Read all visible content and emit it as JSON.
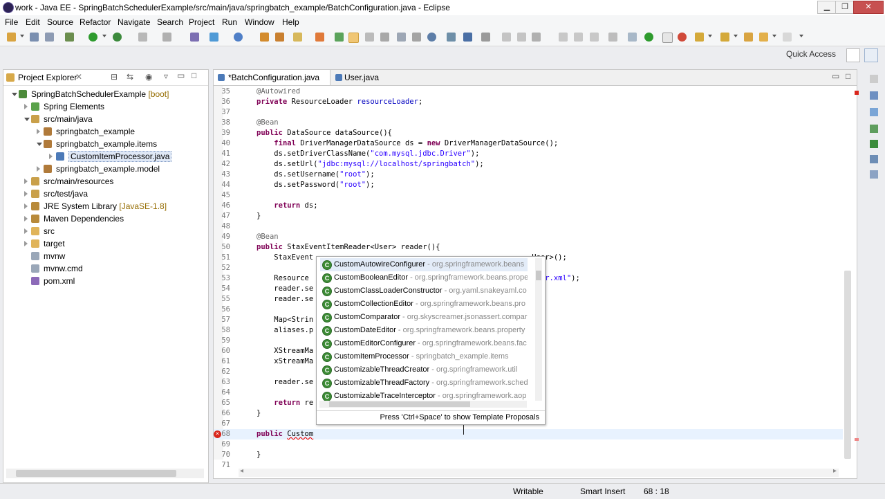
{
  "window": {
    "title": "work - Java EE - SpringBatchSchedulerExample/src/main/java/springbatch_example/BatchConfiguration.java - Eclipse",
    "minimize": "▁",
    "maximize": "❐",
    "close": "✕"
  },
  "menu": [
    "File",
    "Edit",
    "Source",
    "Refactor",
    "Navigate",
    "Search",
    "Project",
    "Run",
    "Window",
    "Help"
  ],
  "toolbar": {
    "quick_access": "Quick Access"
  },
  "explorer": {
    "title": "Project Explorer",
    "tree": [
      {
        "label": "SpringBatchSchedulerExample",
        "decoration": " [boot]",
        "icon": "project-icon",
        "expanded": true
      },
      {
        "label": "Spring Elements",
        "icon": "spring-icon",
        "expanded": false
      },
      {
        "label": "src/main/java",
        "icon": "source-folder-icon",
        "expanded": true
      },
      {
        "label": "springbatch_example",
        "icon": "package-icon",
        "expanded": false
      },
      {
        "label": "springbatch_example.items",
        "icon": "package-icon",
        "expanded": true
      },
      {
        "label": "CustomItemProcessor.java",
        "icon": "java-file-icon",
        "expanded": false,
        "selected": true
      },
      {
        "label": "springbatch_example.model",
        "icon": "package-icon",
        "expanded": false
      },
      {
        "label": "src/main/resources",
        "icon": "source-folder-icon",
        "expanded": false
      },
      {
        "label": "src/test/java",
        "icon": "source-folder-icon",
        "expanded": false
      },
      {
        "label": "JRE System Library",
        "decoration": " [JavaSE-1.8]",
        "icon": "library-icon",
        "expanded": false
      },
      {
        "label": "Maven Dependencies",
        "icon": "library-icon",
        "expanded": false
      },
      {
        "label": "src",
        "icon": "folder-icon",
        "expanded": false
      },
      {
        "label": "target",
        "icon": "folder-icon",
        "expanded": false
      },
      {
        "label": "mvnw",
        "icon": "file-icon",
        "expanded": null
      },
      {
        "label": "mvnw.cmd",
        "icon": "file-icon",
        "expanded": null
      },
      {
        "label": "pom.xml",
        "icon": "xml-file-icon",
        "expanded": null
      }
    ]
  },
  "editor": {
    "tabs": [
      {
        "label": "*BatchConfiguration.java",
        "active": true
      },
      {
        "label": "User.java",
        "active": false
      }
    ],
    "code": [
      {
        "n": "35",
        "html": "<span class='ann'>@Autowired</span>"
      },
      {
        "n": "36",
        "html": "<span class='kw'>private</span> ResourceLoader <span class='fld'>resourceLoader</span>;"
      },
      {
        "n": "37",
        "html": ""
      },
      {
        "n": "38",
        "html": "<span class='ann'>@Bean</span>"
      },
      {
        "n": "39",
        "html": "<span class='kw'>public</span> DataSource dataSource(){"
      },
      {
        "n": "40",
        "html": "    <span class='kw'>final</span> DriverManagerDataSource ds = <span class='kw'>new</span> DriverManagerDataSource();"
      },
      {
        "n": "41",
        "html": "    ds.setDriverClassName(<span class='str'>\"com.mysql.jdbc.Driver\"</span>);"
      },
      {
        "n": "42",
        "html": "    ds.setUrl(<span class='str'>\"jdbc:mysql://localhost/springbatch\"</span>);"
      },
      {
        "n": "43",
        "html": "    ds.setUsername(<span class='str'>\"root\"</span>);"
      },
      {
        "n": "44",
        "html": "    ds.setPassword(<span class='str'>\"root\"</span>);"
      },
      {
        "n": "45",
        "html": ""
      },
      {
        "n": "46",
        "html": "    <span class='kw'>return</span> ds;"
      },
      {
        "n": "47",
        "html": "}"
      },
      {
        "n": "48",
        "html": ""
      },
      {
        "n": "49",
        "html": "<span class='ann'>@Bean</span>"
      },
      {
        "n": "50",
        "html": "<span class='kw'>public</span> StaxEventItemReader&lt;User&gt; reader(){"
      },
      {
        "n": "51",
        "html": "    StaxEvent                                                  User&gt;();"
      },
      {
        "n": "52",
        "html": ""
      },
      {
        "n": "53",
        "html": "    Resource                                                  <span class='str'>/user.xml\"</span>);"
      },
      {
        "n": "54",
        "html": "    reader.se"
      },
      {
        "n": "55",
        "html": "    reader.se"
      },
      {
        "n": "56",
        "html": ""
      },
      {
        "n": "57",
        "html": "    Map&lt;Strin"
      },
      {
        "n": "58",
        "html": "    aliases.p"
      },
      {
        "n": "59",
        "html": ""
      },
      {
        "n": "60",
        "html": "    XStreamMa                                                 );"
      },
      {
        "n": "61",
        "html": "    xStreamMa"
      },
      {
        "n": "62",
        "html": ""
      },
      {
        "n": "63",
        "html": "    reader.se"
      },
      {
        "n": "64",
        "html": ""
      },
      {
        "n": "65",
        "html": "    <span class='kw'>return</span> re"
      },
      {
        "n": "66",
        "html": "}"
      },
      {
        "n": "67",
        "html": ""
      },
      {
        "n": "68",
        "html": "<span class='kw'>public</span> <span style='text-decoration:underline wavy #e00'>Custom</span>"
      },
      {
        "n": "69",
        "html": ""
      },
      {
        "n": "70",
        "html": "}"
      },
      {
        "n": "71",
        "html": ""
      }
    ]
  },
  "autocomplete": {
    "items": [
      {
        "name": "CustomAutowireConfigurer",
        "pkg": " - org.springframework.beans"
      },
      {
        "name": "CustomBooleanEditor",
        "pkg": " - org.springframework.beans.prope"
      },
      {
        "name": "CustomClassLoaderConstructor",
        "pkg": " - org.yaml.snakeyaml.co"
      },
      {
        "name": "CustomCollectionEditor",
        "pkg": " - org.springframework.beans.pro"
      },
      {
        "name": "CustomComparator",
        "pkg": " - org.skyscreamer.jsonassert.compar"
      },
      {
        "name": "CustomDateEditor",
        "pkg": " - org.springframework.beans.property"
      },
      {
        "name": "CustomEditorConfigurer",
        "pkg": " - org.springframework.beans.fac"
      },
      {
        "name": "CustomItemProcessor",
        "pkg": " - springbatch_example.items"
      },
      {
        "name": "CustomizableThreadCreator",
        "pkg": " - org.springframework.util"
      },
      {
        "name": "CustomizableThreadFactory",
        "pkg": " - org.springframework.sched"
      },
      {
        "name": "CustomizableTraceInterceptor",
        "pkg": " - org.springframework.aop"
      }
    ],
    "footer": "Press 'Ctrl+Space' to show Template Proposals"
  },
  "status": {
    "writable": "Writable",
    "insert_mode": "Smart Insert",
    "position": "68 : 18"
  },
  "colors": {
    "keyword": "#7f0055",
    "string": "#2a00ff",
    "annotation": "#646464",
    "field": "#0000c0",
    "class_icon": "#3d8c36"
  }
}
